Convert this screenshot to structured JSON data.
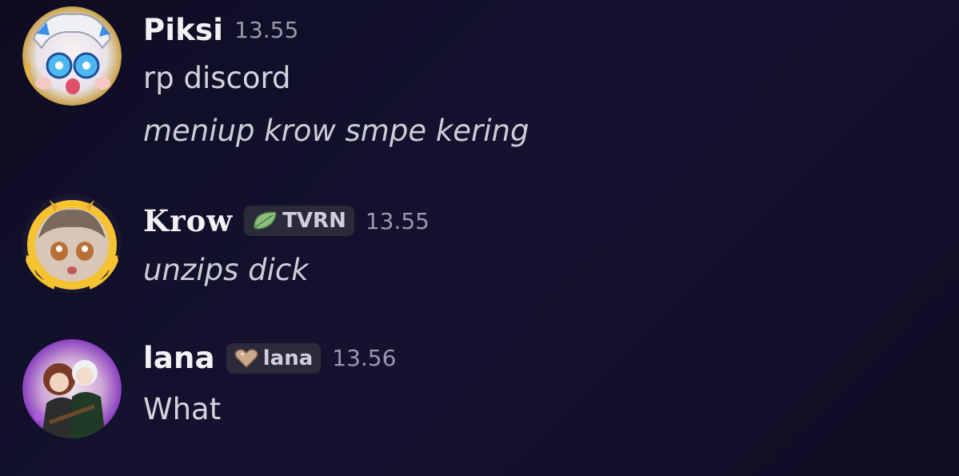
{
  "messages": [
    {
      "author": "Piksi",
      "timestamp": "13.55",
      "tag": null,
      "lines": [
        {
          "text": "rp discord",
          "italic": false
        },
        {
          "text": "meniup krow smpe kering",
          "italic": true
        }
      ],
      "avatar_icon": "anime-character-avatar-icon"
    },
    {
      "author": "Krow",
      "timestamp": "13.55",
      "tag": {
        "icon": "leaf-icon",
        "label": "TVRN"
      },
      "lines": [
        {
          "text": "unzips dick",
          "italic": true
        }
      ],
      "avatar_icon": "anime-character-avatar-icon"
    },
    {
      "author": "lana",
      "timestamp": "13.56",
      "tag": {
        "icon": "heart-icon",
        "label": "lana"
      },
      "lines": [
        {
          "text": "What",
          "italic": false
        }
      ],
      "avatar_icon": "couple-avatar-icon"
    }
  ],
  "colors": {
    "background": "#131028",
    "username": "#f2f2f5",
    "timestamp": "#9a99ab",
    "tag_background": "#2a2a3b",
    "leaf": "#8fbf7f",
    "heart": "#c9ab8a"
  }
}
